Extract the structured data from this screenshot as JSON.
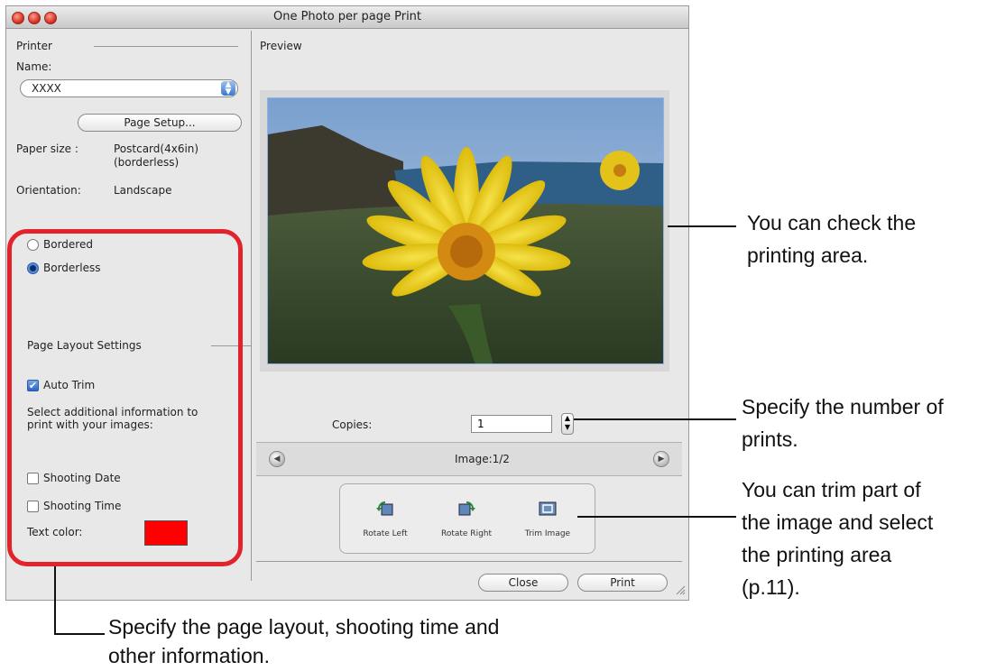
{
  "window": {
    "title": "One Photo per page Print"
  },
  "printer": {
    "section_label": "Printer",
    "name_label": "Name:",
    "name_value": "XXXX",
    "page_setup_button": "Page Setup...",
    "paper_size_label": "Paper size :",
    "paper_size_value_1": "Postcard(4x6in)",
    "paper_size_value_2": "(borderless)",
    "orientation_label": "Orientation:",
    "orientation_value": "Landscape"
  },
  "border_options": {
    "bordered_label": "Bordered",
    "borderless_label": "Borderless",
    "selected": "Borderless"
  },
  "page_layout": {
    "heading": "Page Layout Settings",
    "auto_trim_label": "Auto Trim",
    "auto_trim_checked": true,
    "select_info_line1": "Select additional information to",
    "select_info_line2": "print with your images:",
    "shooting_date_label": "Shooting Date",
    "shooting_date_checked": false,
    "shooting_time_label": "Shooting Time",
    "shooting_time_checked": false,
    "text_color_label": "Text color:",
    "text_color_value": "#ff0000"
  },
  "preview": {
    "heading": "Preview",
    "copies_label": "Copies:",
    "copies_value": "1",
    "image_counter": "Image:1/2"
  },
  "tools": {
    "rotate_left": "Rotate Left",
    "rotate_right": "Rotate Right",
    "trim_image": "Trim Image"
  },
  "buttons": {
    "close": "Close",
    "print": "Print"
  },
  "annotations": {
    "printing_area_1": "You can check the",
    "printing_area_2": "printing area.",
    "copies_1": "Specify the number of",
    "copies_2": "prints.",
    "trim_1": "You can trim part of",
    "trim_2": "the image and select",
    "trim_3": "the printing area",
    "trim_4": "(p.11).",
    "layout_1": "Specify the page layout, shooting time and",
    "layout_2": "other information."
  },
  "colors": {
    "highlight": "#e3232c",
    "accent": "#3a78d0"
  }
}
